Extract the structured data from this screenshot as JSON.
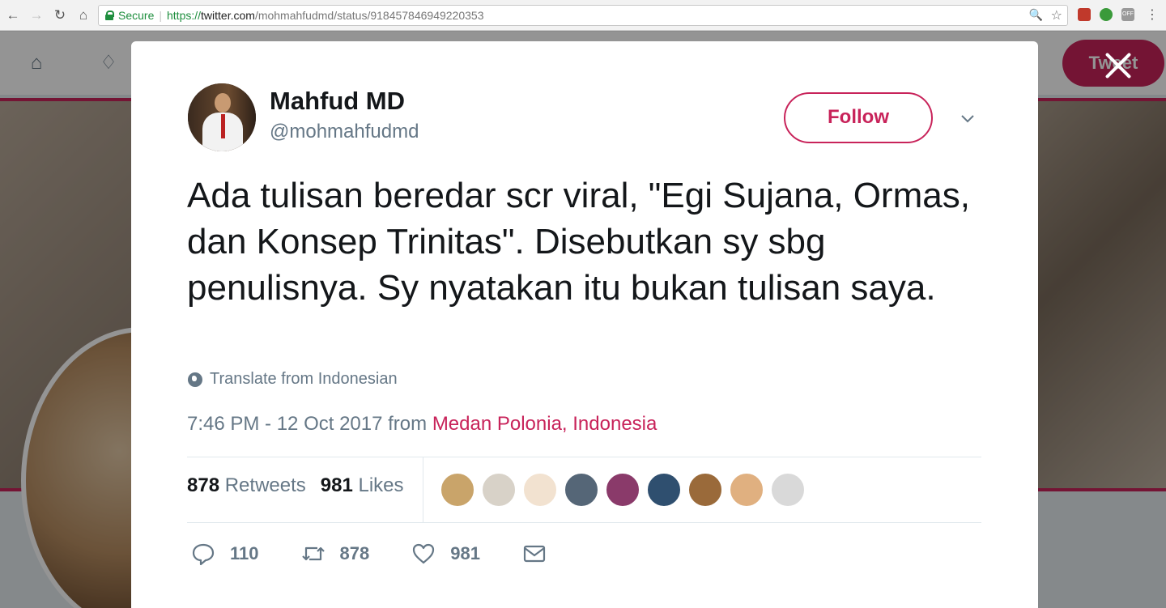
{
  "browser": {
    "secure_label": "Secure",
    "url_proto": "https://",
    "url_host": "twitter.com",
    "url_path": "/mohmahfudmd/status/918457846949220353",
    "ext3_label": "OFF"
  },
  "background": {
    "tweet_button_label": "Tweet"
  },
  "tweet": {
    "author_name": "Mahfud MD",
    "author_handle": "@mohmahfudmd",
    "follow_label": "Follow",
    "text": "Ada tulisan beredar scr viral, \"Egi Sujana, Ormas, dan Konsep Trinitas\". Disebutkan sy sbg penulisnya. Sy nyatakan itu bukan tulisan saya.",
    "translate_label": "Translate from Indonesian",
    "time": "7:46 PM - 12 Oct 2017",
    "from_word": " from ",
    "location": "Medan Polonia, Indonesia",
    "retweets_count": "878",
    "retweets_label": "Retweets",
    "likes_count": "981",
    "likes_label": "Likes",
    "reply_count": "110",
    "retweet_action_count": "878",
    "like_action_count": "981"
  },
  "colors": {
    "accent": "#c8235a",
    "secondary_text": "#657786",
    "primary_text": "#14171a"
  },
  "likers": [
    {
      "color": "#c9a46a"
    },
    {
      "color": "#d8d2c8"
    },
    {
      "color": "#f2e2d0"
    },
    {
      "color": "#556677"
    },
    {
      "color": "#8a3a6a"
    },
    {
      "color": "#2f4f6f"
    },
    {
      "color": "#9a6a3a"
    },
    {
      "color": "#e0b080"
    },
    {
      "color": "#d9d9d9"
    }
  ]
}
